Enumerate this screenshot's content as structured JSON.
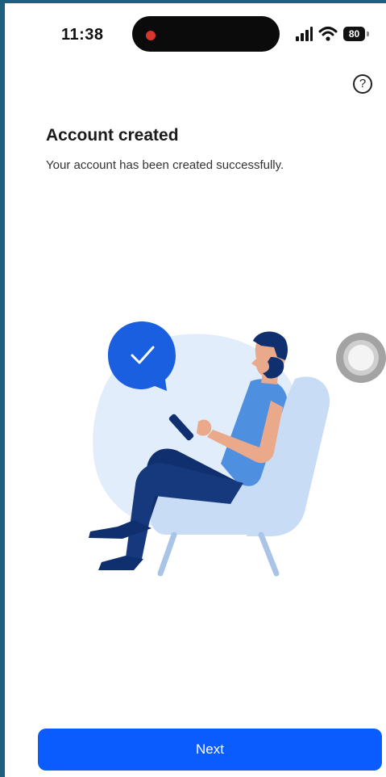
{
  "status_bar": {
    "time": "11:38",
    "battery_level": "80",
    "icons": [
      "recording-dot-icon",
      "signal-icon",
      "wifi-icon",
      "battery-icon"
    ]
  },
  "header": {
    "help_icon": "question-mark-circle-icon",
    "help_symbol": "?"
  },
  "main": {
    "title": "Account created",
    "subtitle": "Your account has been created successfully.",
    "illustration": {
      "badge_icon": "checkmark-icon",
      "subject": "person-in-armchair-with-phone"
    }
  },
  "footer": {
    "next_label": "Next"
  },
  "colors": {
    "primary": "#0a5cff",
    "badge": "#1a5fe0",
    "illustration_blob": "#e1edfb",
    "chair": "#c9dcf6",
    "trousers": "#0f2f6e",
    "shirt": "#4f8fe0",
    "skin": "#e9a98a",
    "frame": "#1d5f7e"
  }
}
